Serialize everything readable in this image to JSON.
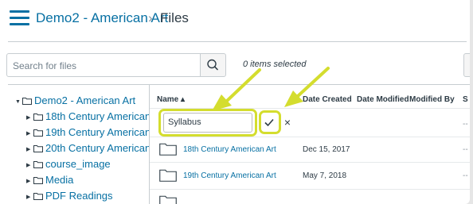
{
  "header": {
    "course_link": "Demo2 - American Art",
    "separator": "›",
    "current_page": "Files"
  },
  "toolbar": {
    "search_placeholder": "Search for files",
    "items_selected": "0 items selected"
  },
  "tree": {
    "root": "Demo2 - American Art",
    "folders": [
      "18th Century American Art",
      "19th Century American Art",
      "20th Century American Art",
      "course_image",
      "Media",
      "PDF Readings"
    ]
  },
  "table": {
    "columns": {
      "name": "Name ▴",
      "date_created": "Date Created",
      "date_modified": "Date Modified",
      "modified_by": "Modified By",
      "size": "S"
    },
    "new_folder_input": "Syllabus",
    "cancel_symbol": "×",
    "empty_cell": "--",
    "rows": [
      {
        "name": "18th Century American Art",
        "date_created": "Dec 15, 2017",
        "modified_by": "--"
      },
      {
        "name": "19th Century American Art",
        "date_created": "May 7, 2018",
        "modified_by": "--"
      }
    ]
  },
  "colors": {
    "link": "#0770a3",
    "highlight": "#d4dd2e",
    "text": "#2d3b45"
  },
  "icons": [
    "hamburger-icon",
    "search-icon",
    "folder-icon",
    "checkmark-icon",
    "close-icon"
  ]
}
